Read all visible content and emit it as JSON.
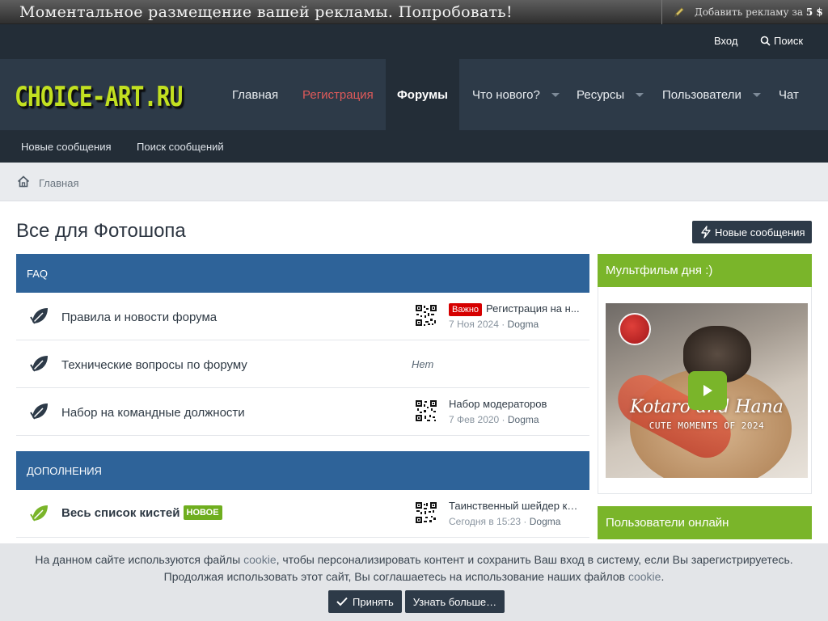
{
  "adbar": {
    "text": "Моментальное размещение вашей рекламы. Попробовать!",
    "add_ad_prefix": "Добавить рекламу за",
    "add_ad_price": "5 $"
  },
  "userbar": {
    "login": "Вход",
    "search": "Поиск"
  },
  "logo": "CHOICE-ART.RU",
  "nav": {
    "home": "Главная",
    "register": "Регистрация",
    "forums": "Форумы",
    "whats_new": "Что нового?",
    "resources": "Ресурсы",
    "members": "Пользователи",
    "chat": "Чат"
  },
  "subnav": {
    "new_posts": "Новые сообщения",
    "search_posts": "Поиск сообщений"
  },
  "breadcrumb": {
    "home": "Главная"
  },
  "page": {
    "title": "Все для Фотошопа",
    "new_posts_button": "Новые сообщения"
  },
  "categories": [
    {
      "title": "FAQ"
    },
    {
      "title": "ДОПОЛНЕНИЯ"
    }
  ],
  "forums": [
    {
      "title": "Правила и новости форума",
      "prefix": "Важно",
      "last_post": "Регистрация на н...",
      "date": "7 Ноя 2024",
      "user": "Dogma"
    },
    {
      "title": "Технические вопросы по форуму",
      "none": "Нет"
    },
    {
      "title": "Набор на командные должности",
      "last_post": "Набор модераторов",
      "date": "7 Фев 2020",
      "user": "Dogma"
    },
    {
      "title": "Весь список кистей",
      "badge": "НОВОЕ",
      "last_post": "Таинственный шейдер ки...",
      "date": "Сегодня в 15:23",
      "user": "Dogma"
    }
  ],
  "sidebar": {
    "cartoon_title": "Мультфильм дня :)",
    "video_title": "Kotaro and Hana",
    "video_subtitle": "CUTE MOMENTS OF 2024",
    "online_title": "Пользователи онлайн"
  },
  "cookie": {
    "line1_a": "На данном сайте используются файлы",
    "line1_link": "cookie",
    "line1_b": ", чтобы персонализировать контент и сохранить Ваш вход в систему, если Вы зарегистрируетесь.",
    "line2_a": "Продолжая использовать этот сайт, Вы соглашаетесь на использование наших файлов",
    "line2_link": "cookie",
    "line2_b": ".",
    "accept": "Принять",
    "learn_more": "Узнать больше…"
  },
  "colors": {
    "nav_bg": "#2d3a48",
    "dark_bg": "#232d37",
    "category_blue": "#2e6399",
    "sidebar_green": "#7ab52a",
    "register_red": "#e05a5a",
    "important_red": "#d60000"
  }
}
